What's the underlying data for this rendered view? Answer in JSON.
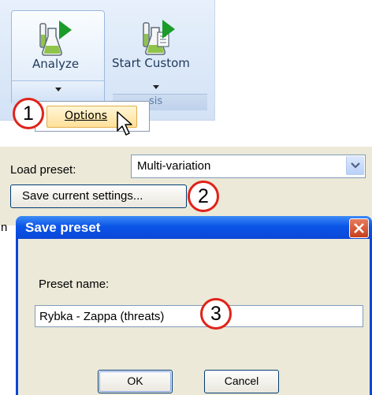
{
  "ribbon": {
    "analyze_label": "Analyze",
    "start_custom_label": "Start Custom",
    "group_caption_fragment": "sis",
    "options_item": "Options"
  },
  "preset": {
    "load_label": "Load preset:",
    "selected_value": "Multi-variation",
    "save_button": "Save current settings...",
    "partial_text": "n"
  },
  "dialog": {
    "title": "Save preset",
    "name_label": "Preset name:",
    "name_value": "Rybka - Zappa (threats)",
    "ok_label": "OK",
    "cancel_label": "Cancel"
  },
  "steps": [
    "1",
    "2",
    "3"
  ],
  "colors": {
    "step_ring": "#e0231a",
    "titlebar": "#0a47d8",
    "dialog_face": "#ece9d8",
    "ribbon_bg": "#dbe8f8"
  },
  "icons": [
    "flask-play-icon",
    "flask-document-icon",
    "close-icon",
    "dropdown-arrow-icon",
    "mouse-cursor-icon"
  ]
}
